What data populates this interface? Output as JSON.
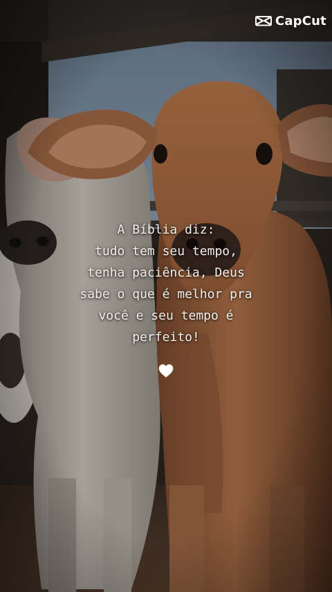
{
  "watermark": {
    "brand": "CapCut",
    "icon": "capcut-logo-icon"
  },
  "quote": {
    "lines": [
      "A Bíblia diz:",
      "tudo tem seu tempo,",
      "tenha paciência, Deus",
      "sabe o que é melhor pra",
      "você e seu tempo é",
      "perfeito!"
    ]
  },
  "decoration": {
    "heart_icon": "white-heart-icon",
    "heart_color": "#ffffff"
  },
  "photo": {
    "subject": "two young calves"
  },
  "colors": {
    "text": "#f4f1ec",
    "sky": "#7f93a8",
    "calf_brown": "#a8683f",
    "calf_white": "#cfc6bb"
  }
}
